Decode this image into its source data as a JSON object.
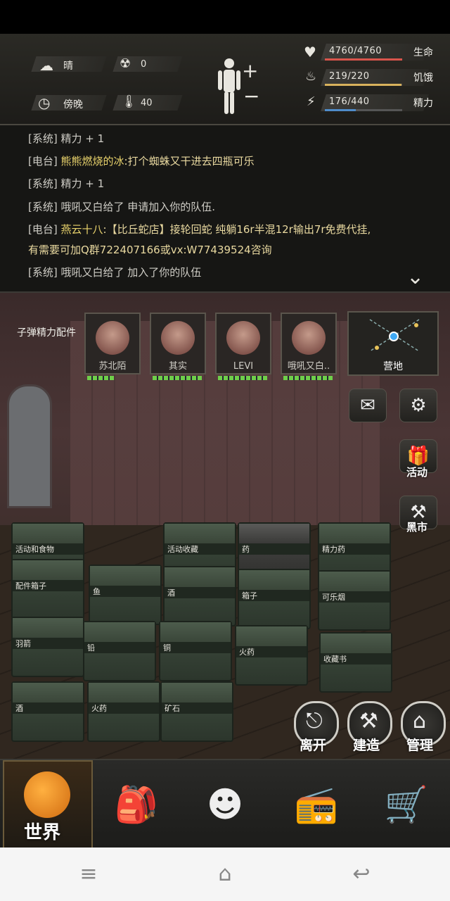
{
  "hud": {
    "weather": "晴",
    "radiation": "0",
    "time_of_day": "傍晚",
    "temperature": "40",
    "stats": [
      {
        "value": "4760/4760",
        "label": "生命",
        "fill": 1.0,
        "color": "#d9554c"
      },
      {
        "value": "219/220",
        "label": "饥饿",
        "fill": 0.995,
        "color": "#d8b25c"
      },
      {
        "value": "176/440",
        "label": "精力",
        "fill": 0.4,
        "color": "#4f8cc9"
      }
    ]
  },
  "log": {
    "lines": [
      {
        "tag": "[系统]",
        "name": "",
        "text": "精力 + 1"
      },
      {
        "tag": "[电台]",
        "name": "熊熊燃烧的冰",
        "text": ":打个蜘蛛又干进去四瓶可乐"
      },
      {
        "tag": "[系统]",
        "name": "",
        "text": "精力 + 1"
      },
      {
        "tag": "[系统]",
        "name": "",
        "text": "哦吼又白给了 申请加入你的队伍."
      },
      {
        "tag": "[电台]",
        "name": "燕云十八",
        "text": ":【比丘蛇店】接轮回蛇 纯躺16r半混12r输出7r免费代挂,"
      },
      {
        "tag": "",
        "name": "",
        "text": "有需要可加Q群722407166或vx:W77439524咨询"
      },
      {
        "tag": "[系统]",
        "name": "",
        "text": "哦吼又白给了 加入了你的队伍"
      }
    ]
  },
  "room": {
    "ammo_label": "子弹精力配件",
    "team": [
      {
        "name": "苏北陌"
      },
      {
        "name": "其实"
      },
      {
        "name": "LEVI"
      },
      {
        "name": "哦吼又白.."
      }
    ],
    "camp_label": "营地",
    "events_label": "活动",
    "blackmarket_label": "黑市",
    "crates": [
      "活动和食物",
      "配件箱子",
      "鱼",
      "活动收藏",
      "药",
      "精力药",
      "酒",
      "箱子",
      "可乐烟",
      "羽箭",
      "铅",
      "铜",
      "火药",
      "收藏书",
      "酒",
      "火药",
      "矿石"
    ],
    "leave_label": "离开",
    "build_label": "建造",
    "manage_label": "管理"
  },
  "nav": {
    "world_label": "世界"
  }
}
